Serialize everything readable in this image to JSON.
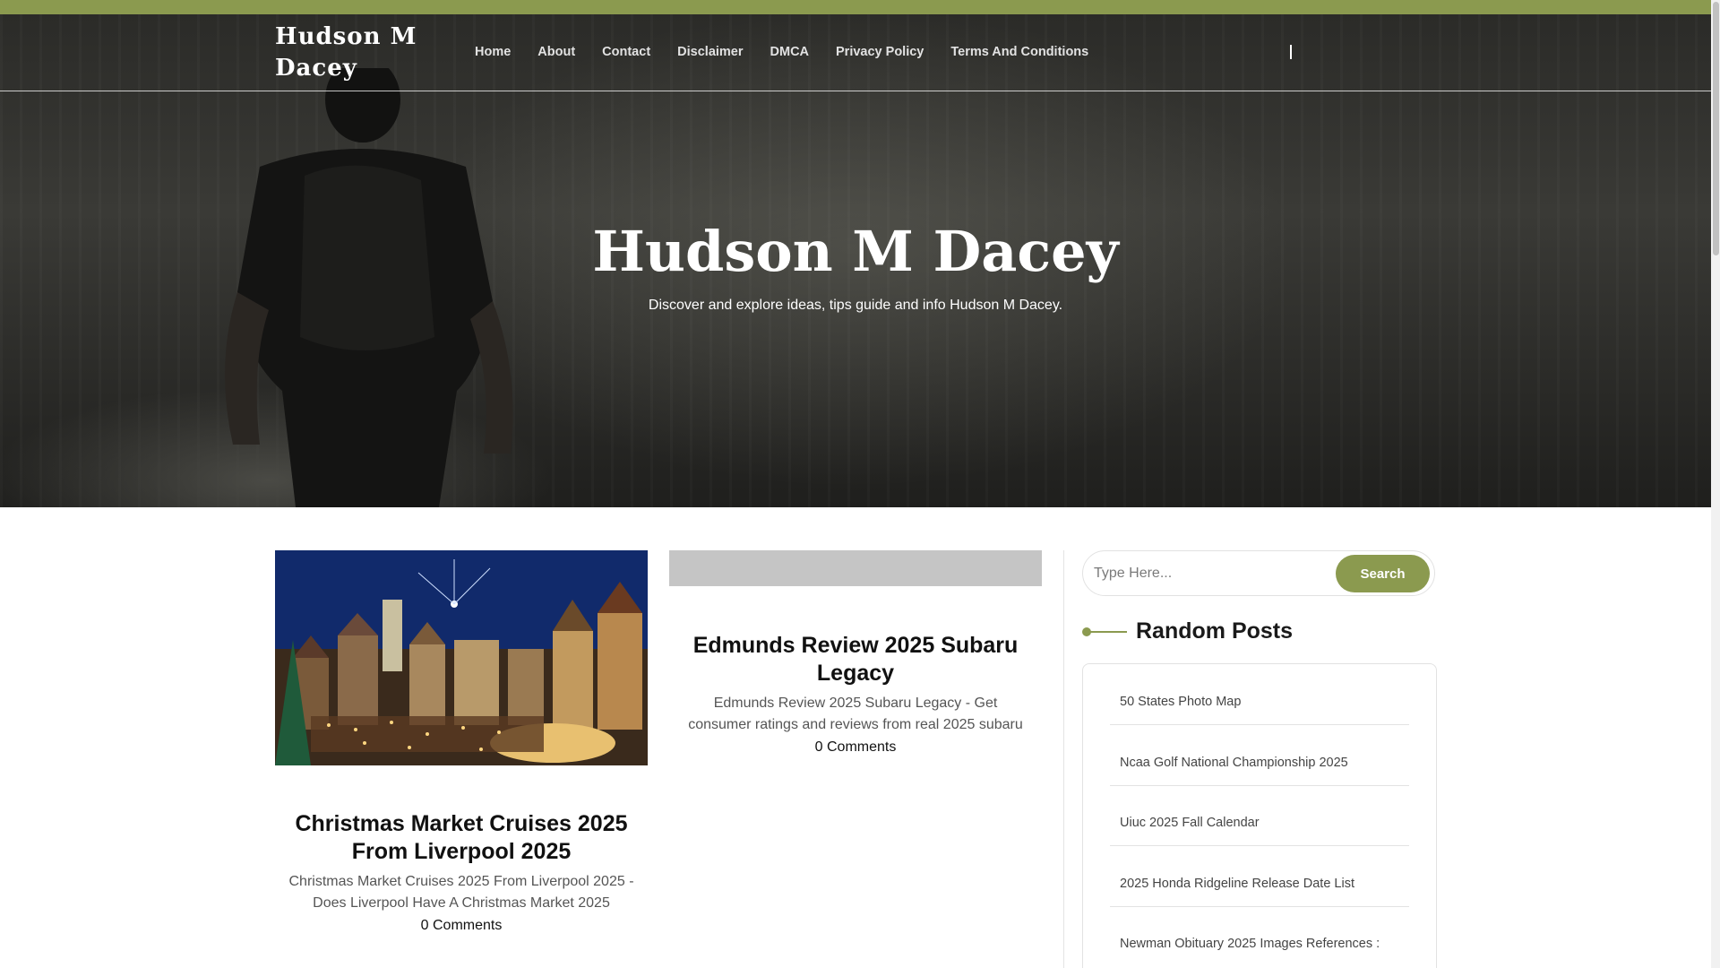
{
  "site": {
    "brand": "Hudson M Dacey",
    "brand_line1": "Hudson M",
    "brand_line2": "Dacey"
  },
  "nav": {
    "items": [
      {
        "label": "Home"
      },
      {
        "label": "About"
      },
      {
        "label": "Contact"
      },
      {
        "label": "Disclaimer"
      },
      {
        "label": "DMCA"
      },
      {
        "label": "Privacy Policy"
      },
      {
        "label": "Terms And Conditions"
      }
    ]
  },
  "hero": {
    "title": "Hudson M Dacey",
    "subtitle": "Discover and explore ideas, tips guide and info Hudson M Dacey."
  },
  "posts": [
    {
      "title": "Christmas Market Cruises 2025 From Liverpool 2025",
      "excerpt": "Christmas Market Cruises 2025 From Liverpool 2025 - Does Liverpool Have A Christmas Market 2025",
      "comments": "0 Comments"
    },
    {
      "title": "Edmunds Review 2025 Subaru Legacy",
      "excerpt": "Edmunds Review 2025 Subaru Legacy - Get consumer ratings and reviews from real 2025 subaru",
      "comments": "0 Comments"
    }
  ],
  "sidebar": {
    "search": {
      "placeholder": "Type Here...",
      "button_label": "Search"
    },
    "random_posts": {
      "heading": "Random Posts",
      "items": [
        {
          "label": "50 States Photo Map"
        },
        {
          "label": "Ncaa Golf National Championship 2025"
        },
        {
          "label": "Uiuc 2025 Fall Calendar"
        },
        {
          "label": "2025 Honda Ridgeline Release Date List"
        },
        {
          "label": "Newman Obituary 2025 Images References :"
        }
      ]
    }
  },
  "colors": {
    "accent": "#8b9a4f",
    "text_dark": "#111111",
    "text_muted": "#555555"
  }
}
